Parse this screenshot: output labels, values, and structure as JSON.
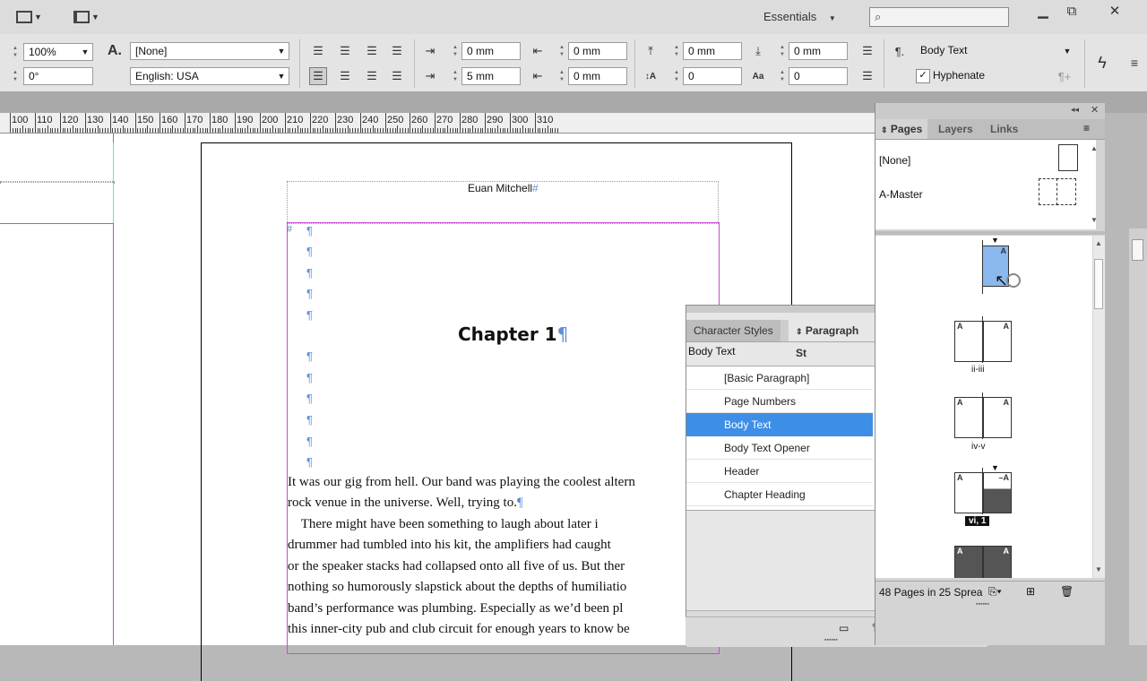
{
  "app": {
    "workspace": "Essentials",
    "search_placeholder": ""
  },
  "control_panel": {
    "zoom": "100%",
    "rotation": "0°",
    "char_style": "[None]",
    "language": "English: USA",
    "left_indent": "0 mm",
    "first_line_indent": "5 mm",
    "right_indent": "0 mm",
    "last_line_indent": "0 mm",
    "space_before": "0 mm",
    "space_after": "0 mm",
    "drop_cap_lines": "0",
    "drop_cap_chars": "0",
    "paragraph_style": "Body Text",
    "hyphenate_label": "Hyphenate",
    "hyphenate_checked": true
  },
  "ruler": {
    "labels": [
      "100",
      "110",
      "120",
      "130",
      "140",
      "150",
      "160",
      "170",
      "180",
      "190",
      "200",
      "210",
      "220",
      "230",
      "240",
      "250",
      "260",
      "270",
      "280",
      "290",
      "300",
      "310"
    ]
  },
  "document": {
    "header_text": "Euan Mitchell",
    "chapter_heading": "Chapter 1",
    "body_lines": [
      "It was our gig from hell. Our band was playing the coolest altern",
      "rock venue in the universe. Well, trying to.",
      "    There might have been something to laugh about later i",
      "drummer had tumbled into his kit, the amplifiers had caught",
      "or the speaker stacks had collapsed onto all five of us. But ther",
      "nothing so humorously slapstick about the depths of humiliatio",
      "band’s performance was plumbing. Especially as we’d been pl",
      "this inner-city pub and club circuit for enough years to know be"
    ]
  },
  "styles_panel": {
    "tabs": [
      "Character Styles",
      "Paragraph St"
    ],
    "current_style": "Body Text",
    "styles": [
      "[Basic Paragraph]",
      "Page Numbers",
      "Body Text",
      "Body Text Opener",
      "Header",
      "Chapter Heading"
    ],
    "selected_index": 2
  },
  "pages_panel": {
    "tabs": [
      "Pages",
      "Layers",
      "Links"
    ],
    "masters": [
      "[None]",
      "A-Master"
    ],
    "spread_labels": [
      "",
      "ii-iii",
      "iv-v",
      "vi, 1",
      ""
    ],
    "footer_text": "48 Pages in 25 Sprea"
  }
}
